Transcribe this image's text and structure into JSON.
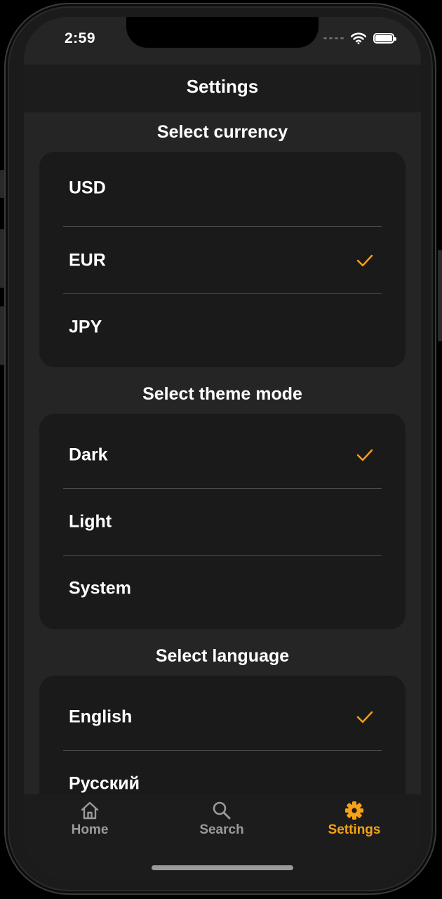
{
  "status_bar": {
    "time": "2:59"
  },
  "nav": {
    "title": "Settings"
  },
  "sections": [
    {
      "title": "Select currency",
      "options": [
        "USD",
        "EUR",
        "JPY"
      ],
      "selected": "EUR"
    },
    {
      "title": "Select theme mode",
      "options": [
        "Dark",
        "Light",
        "System"
      ],
      "selected": "Dark"
    },
    {
      "title": "Select language",
      "options": [
        "English",
        "Русский"
      ],
      "selected": "English"
    }
  ],
  "tabs": [
    {
      "label": "Home",
      "icon": "home-icon",
      "active": false
    },
    {
      "label": "Search",
      "icon": "search-icon",
      "active": false
    },
    {
      "label": "Settings",
      "icon": "gear-icon",
      "active": true
    }
  ],
  "colors": {
    "accent": "#f5a21a",
    "inactive": "#9a9a9a"
  }
}
